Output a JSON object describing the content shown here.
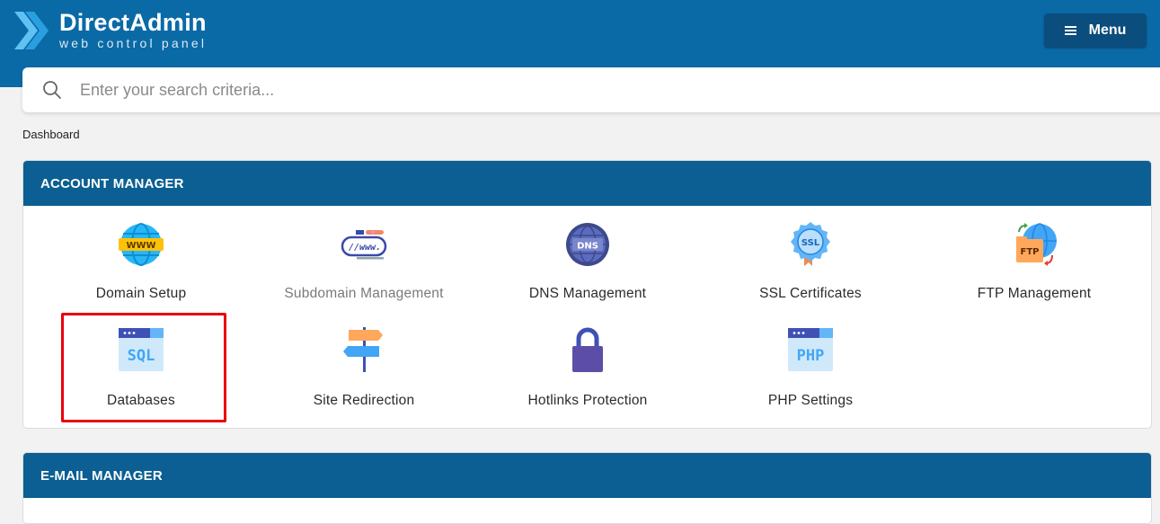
{
  "header": {
    "brand_title": "DirectAdmin",
    "brand_subtitle": "web control panel",
    "menu_label": "Menu"
  },
  "search": {
    "placeholder": "Enter your search criteria..."
  },
  "breadcrumb": "Dashboard",
  "account_manager": {
    "title": "ACCOUNT MANAGER",
    "items": [
      {
        "label": "Domain Setup",
        "icon": "www-globe-icon"
      },
      {
        "label": "Subdomain Management",
        "icon": "subdomain-icon"
      },
      {
        "label": "DNS Management",
        "icon": "dns-icon"
      },
      {
        "label": "SSL Certificates",
        "icon": "ssl-badge-icon"
      },
      {
        "label": "FTP Management",
        "icon": "ftp-icon"
      },
      {
        "label": "Databases",
        "icon": "sql-database-icon"
      },
      {
        "label": "Site Redirection",
        "icon": "signpost-icon"
      },
      {
        "label": "Hotlinks Protection",
        "icon": "padlock-icon"
      },
      {
        "label": "PHP Settings",
        "icon": "php-icon"
      }
    ]
  },
  "email_manager": {
    "title": "E-MAIL MANAGER"
  },
  "colors": {
    "topbar": "#0a6aa6",
    "panel_header": "#0b5f92",
    "menu_button": "#0b4d7c",
    "highlight": "#e8000b"
  }
}
